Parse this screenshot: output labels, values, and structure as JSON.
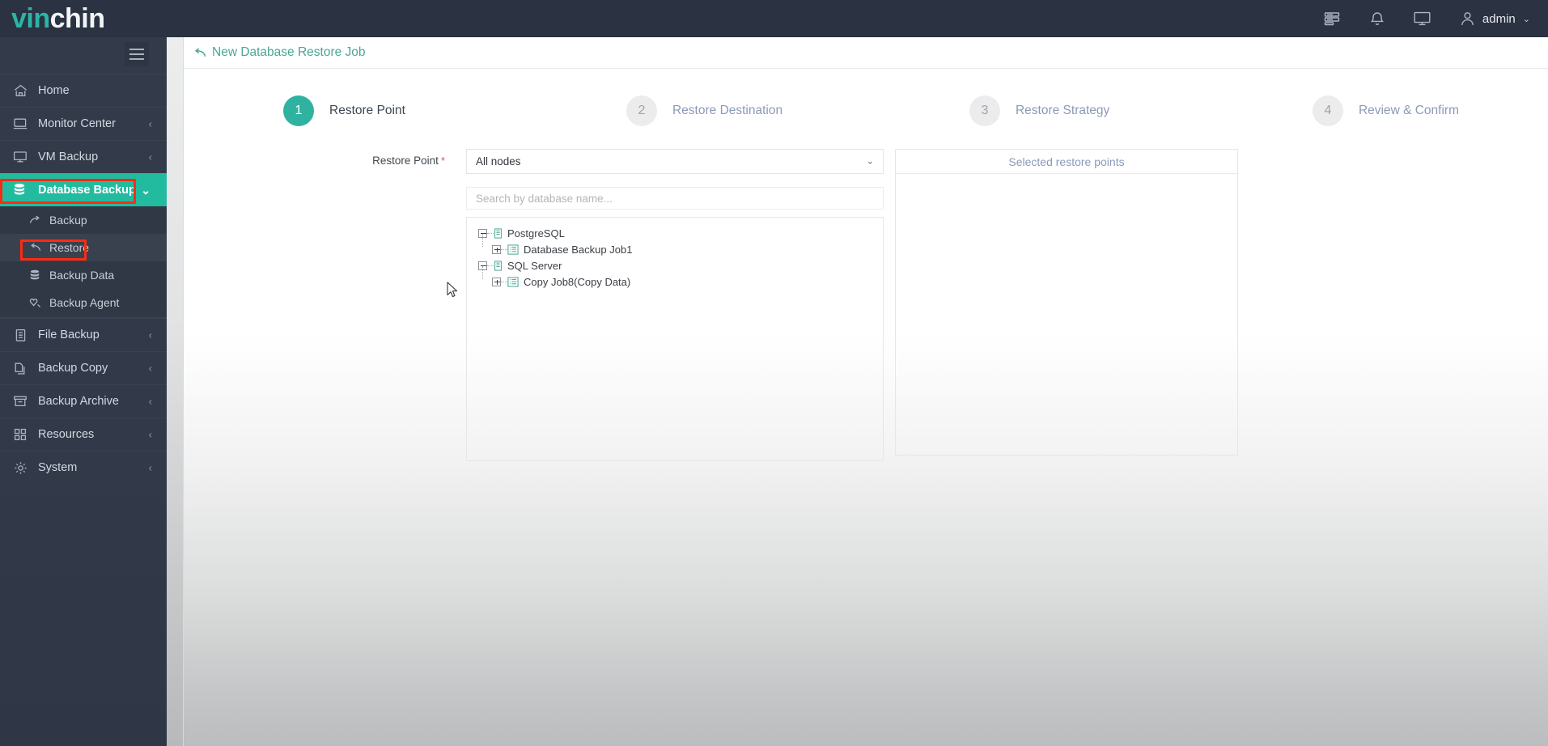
{
  "app": {
    "logo_left": "vin",
    "logo_right": "chin"
  },
  "topbar": {
    "icons": [
      {
        "name": "logs-icon",
        "glyph": "logs"
      },
      {
        "name": "notification-bell-icon",
        "glyph": "bell"
      },
      {
        "name": "console-monitor-icon",
        "glyph": "monitor"
      }
    ],
    "user_label": "admin",
    "user_chevron": "⌄"
  },
  "sidebar": {
    "toggle_name": "sidebar-collapse-toggle",
    "items": [
      {
        "label": "Home",
        "icon": "home-icon",
        "arrow": false,
        "active": false
      },
      {
        "label": "Monitor Center",
        "icon": "monitor-icon",
        "arrow": true,
        "active": false
      },
      {
        "label": "VM Backup",
        "icon": "display-icon",
        "arrow": true,
        "active": false
      },
      {
        "label": "Database Backup",
        "icon": "database-icon",
        "arrow": true,
        "active": true
      },
      {
        "label": "File Backup",
        "icon": "file-icon",
        "arrow": true,
        "active": false
      },
      {
        "label": "Backup Copy",
        "icon": "copy-icon",
        "arrow": true,
        "active": false
      },
      {
        "label": "Backup Archive",
        "icon": "archive-icon",
        "arrow": true,
        "active": false
      },
      {
        "label": "Resources",
        "icon": "grid-icon",
        "arrow": true,
        "active": false
      },
      {
        "label": "System",
        "icon": "gear-icon",
        "arrow": true,
        "active": false
      }
    ],
    "sub_items": [
      {
        "label": "Backup",
        "icon": "backup-arrow-icon",
        "current": false
      },
      {
        "label": "Restore",
        "icon": "restore-arrow-icon",
        "current": true
      },
      {
        "label": "Backup Data",
        "icon": "database-icon",
        "current": false
      },
      {
        "label": "Backup Agent",
        "icon": "agent-icon",
        "current": false
      }
    ],
    "active_arrow": "⌄",
    "collapsed_arrow": "‹"
  },
  "page": {
    "title": "New Database Restore Job",
    "back_icon": "back-arrow-icon"
  },
  "wizard": {
    "steps": [
      {
        "number": "1",
        "label": "Restore Point",
        "state": "active"
      },
      {
        "number": "2",
        "label": "Restore Destination",
        "state": "idle"
      },
      {
        "number": "3",
        "label": "Restore Strategy",
        "state": "idle"
      },
      {
        "number": "4",
        "label": "Review & Confirm",
        "state": "idle"
      }
    ]
  },
  "form": {
    "restore_point_label": "Restore Point",
    "required_mark": "*",
    "node_select": {
      "value": "All nodes",
      "chevron": "⌄",
      "options": [
        "All nodes"
      ]
    },
    "search": {
      "value": "",
      "placeholder": "Search by database name..."
    }
  },
  "tree": [
    {
      "label": "PostgreSQL",
      "expanded": true,
      "toggle": "minus",
      "icon": "db-node-icon",
      "children": [
        {
          "label": "Database Backup Job1",
          "expanded": false,
          "toggle": "plus",
          "icon": "job-list-icon"
        }
      ]
    },
    {
      "label": "SQL Server",
      "expanded": true,
      "toggle": "minus",
      "icon": "db-node-icon",
      "children": [
        {
          "label": "Copy Job8(Copy Data)",
          "expanded": false,
          "toggle": "plus",
          "icon": "job-list-icon"
        }
      ]
    }
  ],
  "selected_panel": {
    "title": "Selected restore points",
    "items": []
  },
  "annotations": [
    {
      "name": "highlight-database-backup",
      "target": "Database Backup"
    },
    {
      "name": "highlight-restore",
      "target": "Restore"
    }
  ],
  "colors": {
    "brand_teal": "#23bba0",
    "sidebar_bg": "#333b4b",
    "topbar_bg": "#2b3241",
    "step_active": "#2fb3a0",
    "step_idle_text": "#8b9ab5",
    "annotation_red": "#fb2b13",
    "title_teal": "#4aa695"
  }
}
